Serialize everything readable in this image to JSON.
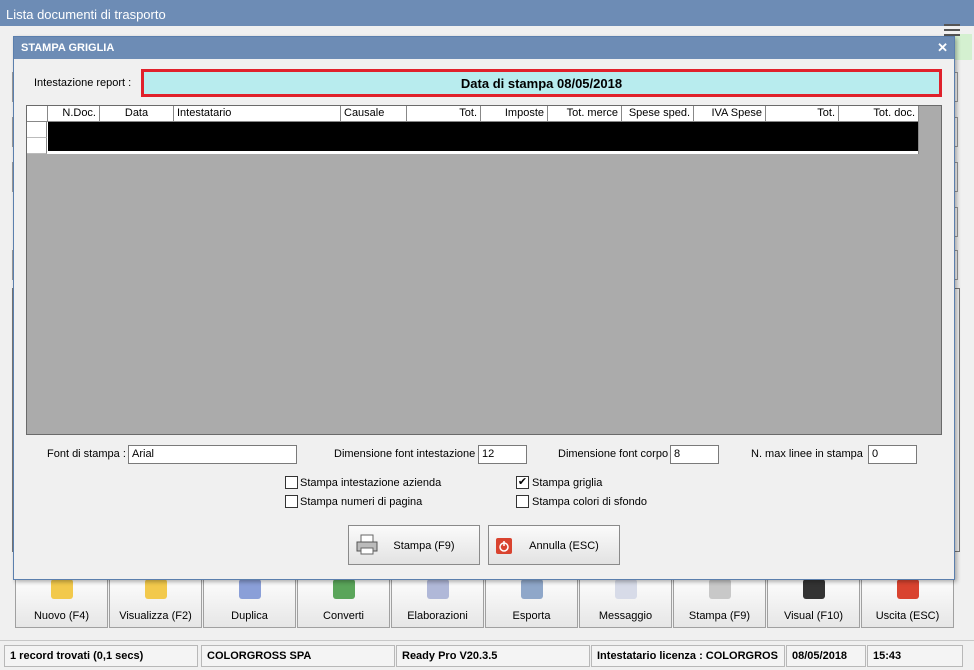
{
  "main_window": {
    "title": "Lista documenti di trasporto"
  },
  "dialog": {
    "title": "STAMPA GRIGLIA",
    "report_label": "Intestazione report :",
    "report_value": "Data di stampa 08/05/2018",
    "columns": [
      "N.Doc.",
      "Data",
      "Intestatario",
      "Causale",
      "Tot.",
      "Imposte",
      "Tot. merce",
      "Spese sped.",
      "IVA Spese",
      "Tot.",
      "Tot. doc."
    ],
    "font_label": "Font di stampa :",
    "font_value": "Arial",
    "dim_header_label": "Dimensione font intestazione",
    "dim_header_value": "12",
    "dim_body_label": "Dimensione font corpo",
    "dim_body_value": "8",
    "max_lines_label": "N. max linee in stampa",
    "max_lines_value": "0",
    "checkboxes": [
      {
        "label": "Stampa intestazione azienda",
        "checked": false
      },
      {
        "label": "Stampa numeri di pagina",
        "checked": false
      },
      {
        "label": "Stampa griglia",
        "checked": true
      },
      {
        "label": "Stampa colori di sfondo",
        "checked": false
      }
    ],
    "print_button": "Stampa (F9)",
    "cancel_button": "Annulla (ESC)"
  },
  "toolbar": [
    {
      "label": "Nuovo (F4)",
      "icon": "new-document-icon"
    },
    {
      "label": "Visualizza (F2)",
      "icon": "view-grid-icon"
    },
    {
      "label": "Duplica",
      "icon": "duplicate-icon"
    },
    {
      "label": "Converti",
      "icon": "convert-icon"
    },
    {
      "label": "Elaborazioni",
      "icon": "process-gear-icon"
    },
    {
      "label": "Esporta",
      "icon": "export-database-icon"
    },
    {
      "label": "Messaggio",
      "icon": "message-pen-icon"
    },
    {
      "label": "Stampa (F9)",
      "icon": "printer-icon"
    },
    {
      "label": "Visual (F10)",
      "icon": "wand-icon"
    },
    {
      "label": "Uscita (ESC)",
      "icon": "power-exit-icon"
    }
  ],
  "status_bar": {
    "records": "1 record trovati (0,1 secs)",
    "company": "COLORGROSS SPA",
    "version": "Ready Pro V20.3.5",
    "license": "Intestatario licenza : COLORGROS",
    "date": "08/05/2018",
    "time": "15:43"
  },
  "colors": {
    "title_bar": "#6d8cb5",
    "report_bg": "#b8ecee",
    "highlight_border": "#e0212b",
    "grid_bg": "#ababab"
  }
}
